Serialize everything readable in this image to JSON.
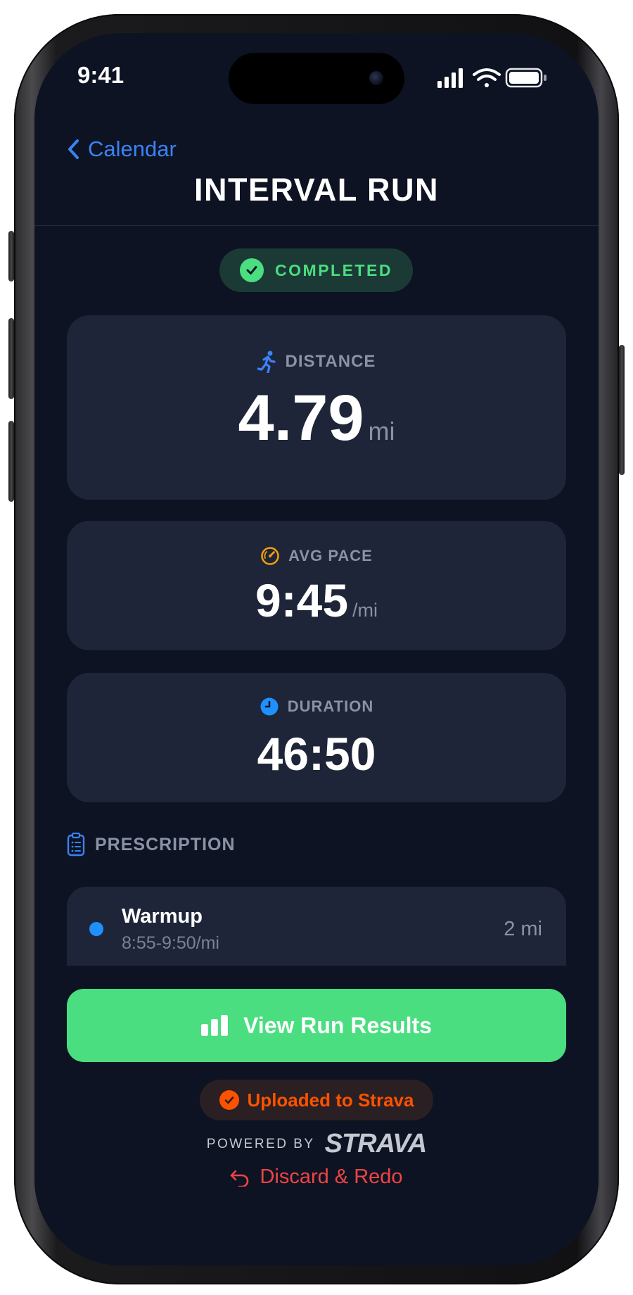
{
  "status_bar": {
    "time": "9:41",
    "icons": [
      "signal-icon",
      "wifi-icon",
      "battery-icon"
    ]
  },
  "nav": {
    "back_label": "Calendar",
    "title": "INTERVAL RUN"
  },
  "badge": {
    "label": "COMPLETED",
    "color": "#4ade80"
  },
  "stats": {
    "distance": {
      "label": "DISTANCE",
      "value": "4.79",
      "unit": "mi",
      "icon": "runner-icon",
      "icon_color": "#3b82f6"
    },
    "pace": {
      "label": "AVG PACE",
      "value": "9:45",
      "unit": "/mi",
      "icon": "speedometer-icon",
      "icon_color": "#f59e0b"
    },
    "duration": {
      "label": "DURATION",
      "value": "46:50",
      "icon": "clock-icon",
      "icon_color": "#1e90ff"
    }
  },
  "prescription": {
    "heading": "PRESCRIPTION",
    "items": [
      {
        "title": "Warmup",
        "pace": "8:55-9:50/mi",
        "distance": "2 mi",
        "dot_color": "#1e90ff"
      }
    ]
  },
  "actions": {
    "view_results_label": "View Run Results",
    "strava_status": "Uploaded to Strava",
    "powered_by": "POWERED BY",
    "strava_logo": "STRAVA",
    "discard_label": "Discard & Redo"
  },
  "colors": {
    "background": "#0d1322",
    "card": "#1e2538",
    "accent_green": "#4ade80",
    "strava_orange": "#fc5200",
    "danger": "#ef4444",
    "link_blue": "#3b82f6"
  }
}
